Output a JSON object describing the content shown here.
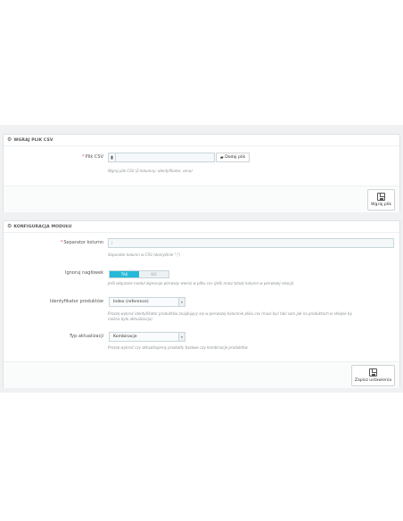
{
  "upload_panel": {
    "title": "WGRAJ PLIK CSV",
    "csv_label": "Plik CSV",
    "add_file_label": "Dodaj plik",
    "help": "Wgraj plik CSV (2 kolumny: identyfikator, cena)",
    "save_label": "Wgraj plik"
  },
  "config_panel": {
    "title": "KONFIGURACJA MODUŁU",
    "separator": {
      "label": "Separator kolumn",
      "value": ";",
      "help": "Separator kolumn w CSV (domyślnie \";\")"
    },
    "ignore_header": {
      "label": "Ignoruj nagłówek",
      "on_label": "TAK",
      "off_label": "NIE",
      "value": true,
      "help": "Jeśli włączone moduł zignoruje pierwszy wiersz w pliku csv (jeśli masz tytuły kolumn w pierwszej relacji)"
    },
    "identifier": {
      "label": "Identyfikator produktów",
      "selected": "Index (reference)",
      "help_line1": "Proszę wybrać identyfikator produktów znajdujący się w pierwszej kolumnie pliku csv (musi być taki sam jak na produktach w sklepie by",
      "help_line2": "można było aktualizacja)"
    },
    "update_type": {
      "label": "Typ aktualizacji",
      "selected": "Kombinacje",
      "help": "Proszę wybrać czy aktualizujemy produkty bazowe czy kombinacje produktów"
    },
    "save_label": "Zapisz ustawienia"
  },
  "icons": {
    "cog": "cog-icon",
    "file": "file-icon",
    "folder": "folder-open-icon",
    "save": "floppy-disk-icon",
    "caret": "caret-down-icon"
  },
  "colors": {
    "toggle_on": "#25b9d7",
    "required": "#e04b4b",
    "page_bg": "#eff1f2"
  }
}
